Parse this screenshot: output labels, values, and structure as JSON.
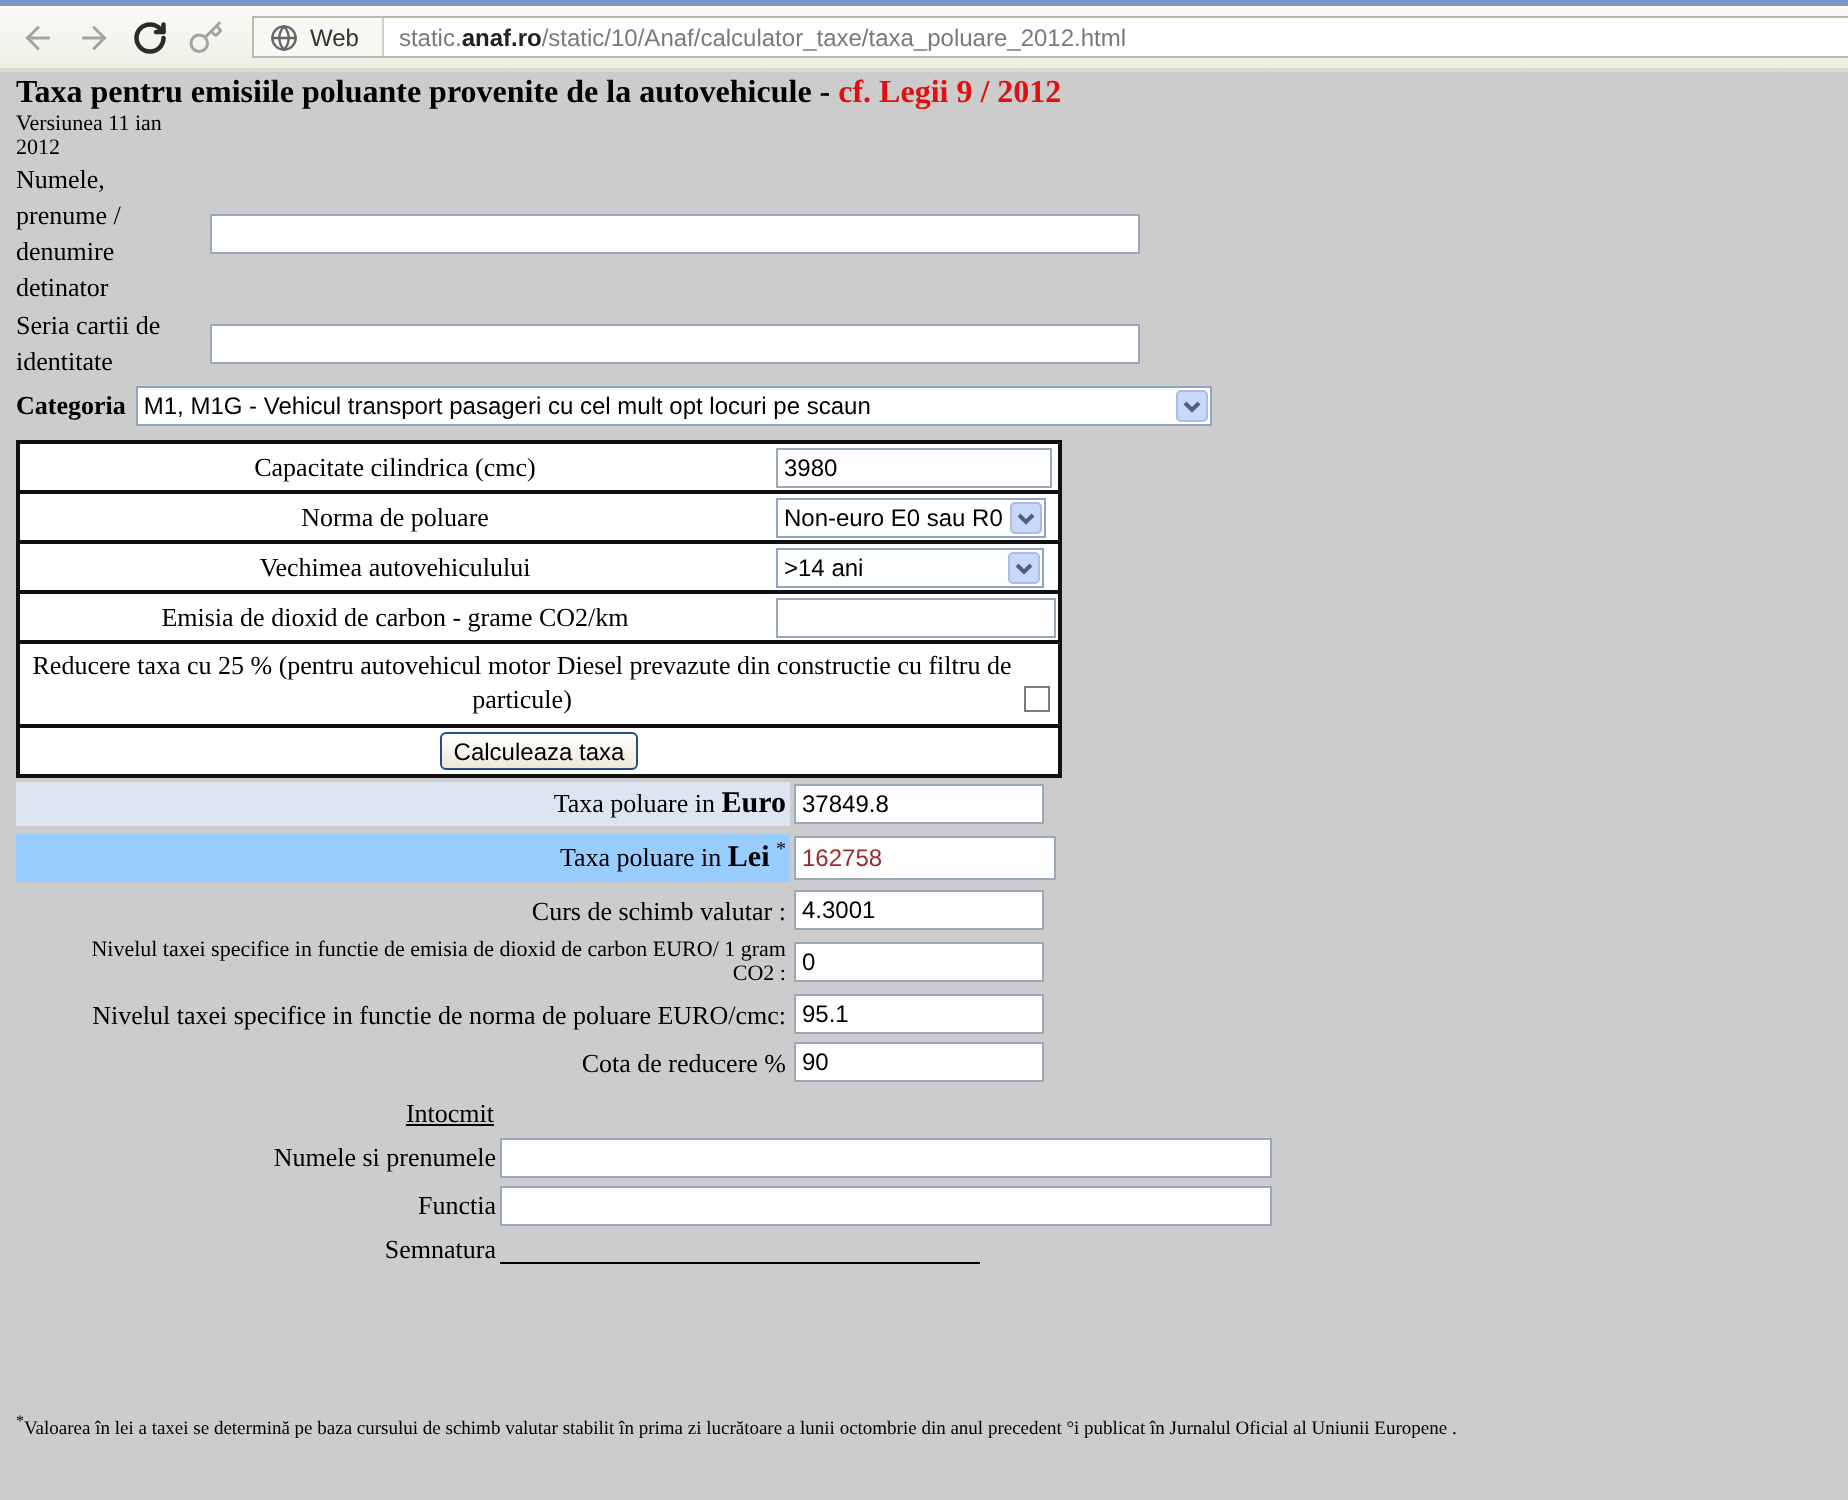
{
  "browser": {
    "nav": [
      {
        "kind": "back",
        "disabled": true
      },
      {
        "kind": "forward",
        "disabled": true
      },
      {
        "kind": "reload",
        "disabled": false
      },
      {
        "kind": "key",
        "disabled": true
      }
    ],
    "site_label": "Web",
    "url": "static.**anaf.ro**/static/10/Anaf/calculator_taxe/taxa_poluare_2012.html"
  },
  "header": {
    "title": "Taxa pentru emisiile poluante provenite de la autovehicule -",
    "law": "cf. Legii 9 / 2012",
    "version": "Versiunea 11 ian 2012"
  },
  "owner_fields": [
    {
      "label": "Numele, prenume / denumire detinator"
    },
    {
      "label": "Seria cartii de identitate"
    }
  ],
  "category": {
    "label": "Categoria",
    "value": "M1, M1G - Vehicul transport pasageri cu cel mult opt locuri pe scaun"
  },
  "vehicle_rows": [
    {
      "kind": "input",
      "label": "Capacitate cilindrica (cmc)",
      "value": "3980"
    },
    {
      "kind": "select",
      "label": "Norma de poluare",
      "value": "Non-euro E0 sau R0"
    },
    {
      "kind": "select",
      "label": "Vechimea autovehiculului",
      "value": ">14 ani"
    },
    {
      "kind": "input",
      "label": "Emisia de dioxid de carbon - grame CO2/km"
    },
    {
      "kind": "checkbox",
      "label": "Reducere taxa cu 25 % (pentru autovehicul motor Diesel prevazute din constructie cu filtru de particule)",
      "checked": false
    }
  ],
  "calculate_button": "Calculeaza taxa",
  "results": [
    {
      "kind": "primary",
      "label": "Taxa poluare in **Euro**",
      "value": "37849.8"
    },
    {
      "kind": "total",
      "label": "Taxa poluare in **Lei** $^{*}$",
      "value": "162758"
    },
    {
      "kind": "plain",
      "label": "Curs de schimb valutar :",
      "value": "4.3001"
    },
    {
      "kind": "small",
      "label": "Nivelul taxei specifice in functie de emisia de dioxid de carbon EURO/ 1 gram CO2 :",
      "value": "0"
    },
    {
      "kind": "plain",
      "label": "Nivelul taxei specifice in functie de norma de poluare EURO/cmc:",
      "value": "95.1"
    },
    {
      "kind": "plain",
      "label": "Cota de reducere %",
      "value": "90"
    }
  ],
  "prepared_by": {
    "heading": "Intocmit",
    "fields": [
      {
        "kind": "input",
        "label": "Numele si prenumele"
      },
      {
        "kind": "input",
        "label": "Functia"
      },
      {
        "kind": "line",
        "label": "Semnatura"
      }
    ]
  },
  "footnote": "$^{*}$Valoarea în lei a taxei se determină pe baza cursului de schimb valutar stabilit în prima zi lucrătoare a lunii octombrie din anul precedent °i publicat în Jurnalul Oficial al Uniunii Europene ."
}
